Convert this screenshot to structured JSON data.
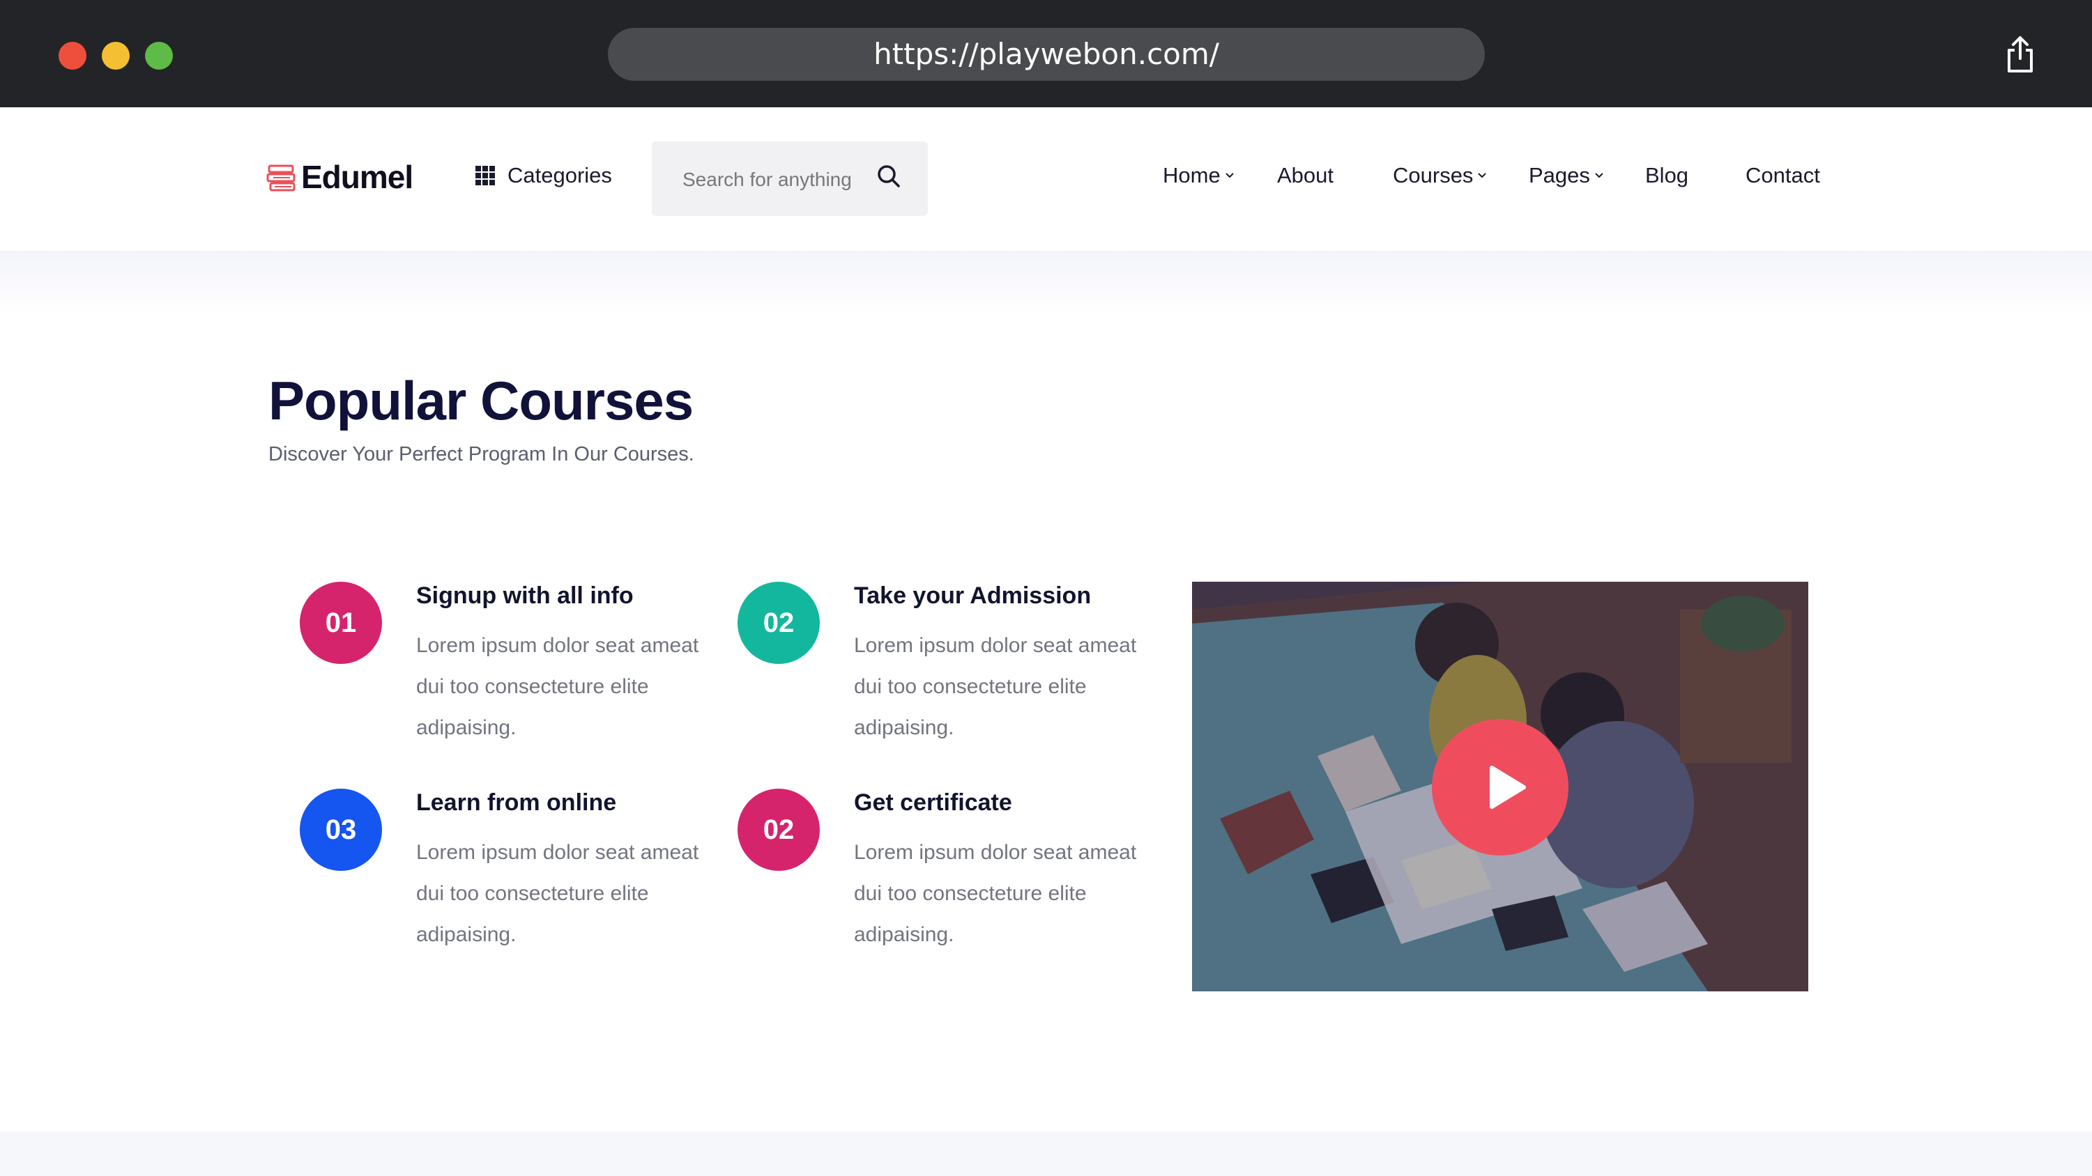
{
  "browser": {
    "url": "https://playwebon.com/"
  },
  "header": {
    "logo_text": "Edumel",
    "categories_label": "Categories",
    "search_placeholder": "Search for anything",
    "nav": [
      {
        "label": "Home",
        "dropdown": true
      },
      {
        "label": "About",
        "dropdown": false
      },
      {
        "label": "Courses",
        "dropdown": true
      },
      {
        "label": "Pages",
        "dropdown": true
      },
      {
        "label": "Blog",
        "dropdown": false
      },
      {
        "label": "Contact",
        "dropdown": false
      }
    ]
  },
  "section": {
    "title": "Popular Courses",
    "subtitle": "Discover Your Perfect Program In Our Courses."
  },
  "steps": [
    {
      "number": "01",
      "title": "Signup with all info",
      "text": "Lorem ipsum dolor seat ameat dui too consecteture elite adipaising.",
      "color": "#d6246c"
    },
    {
      "number": "02",
      "title": "Take your Admission",
      "text": "Lorem ipsum dolor seat ameat dui too consecteture elite adipaising.",
      "color": "#13b79e"
    },
    {
      "number": "03",
      "title": "Learn from online",
      "text": "Lorem ipsum dolor seat ameat dui too consecteture elite adipaising.",
      "color": "#1555f0"
    },
    {
      "number": "02",
      "title": "Get certificate",
      "text": "Lorem ipsum dolor seat ameat dui too consecteture elite adipaising.",
      "color": "#d6246c"
    }
  ],
  "video": {
    "play_color": "#ef4d5e",
    "icon": "play-icon"
  },
  "colors": {
    "brand_logo": "#e8505b",
    "heading": "#10123a",
    "chrome": "#232427"
  }
}
